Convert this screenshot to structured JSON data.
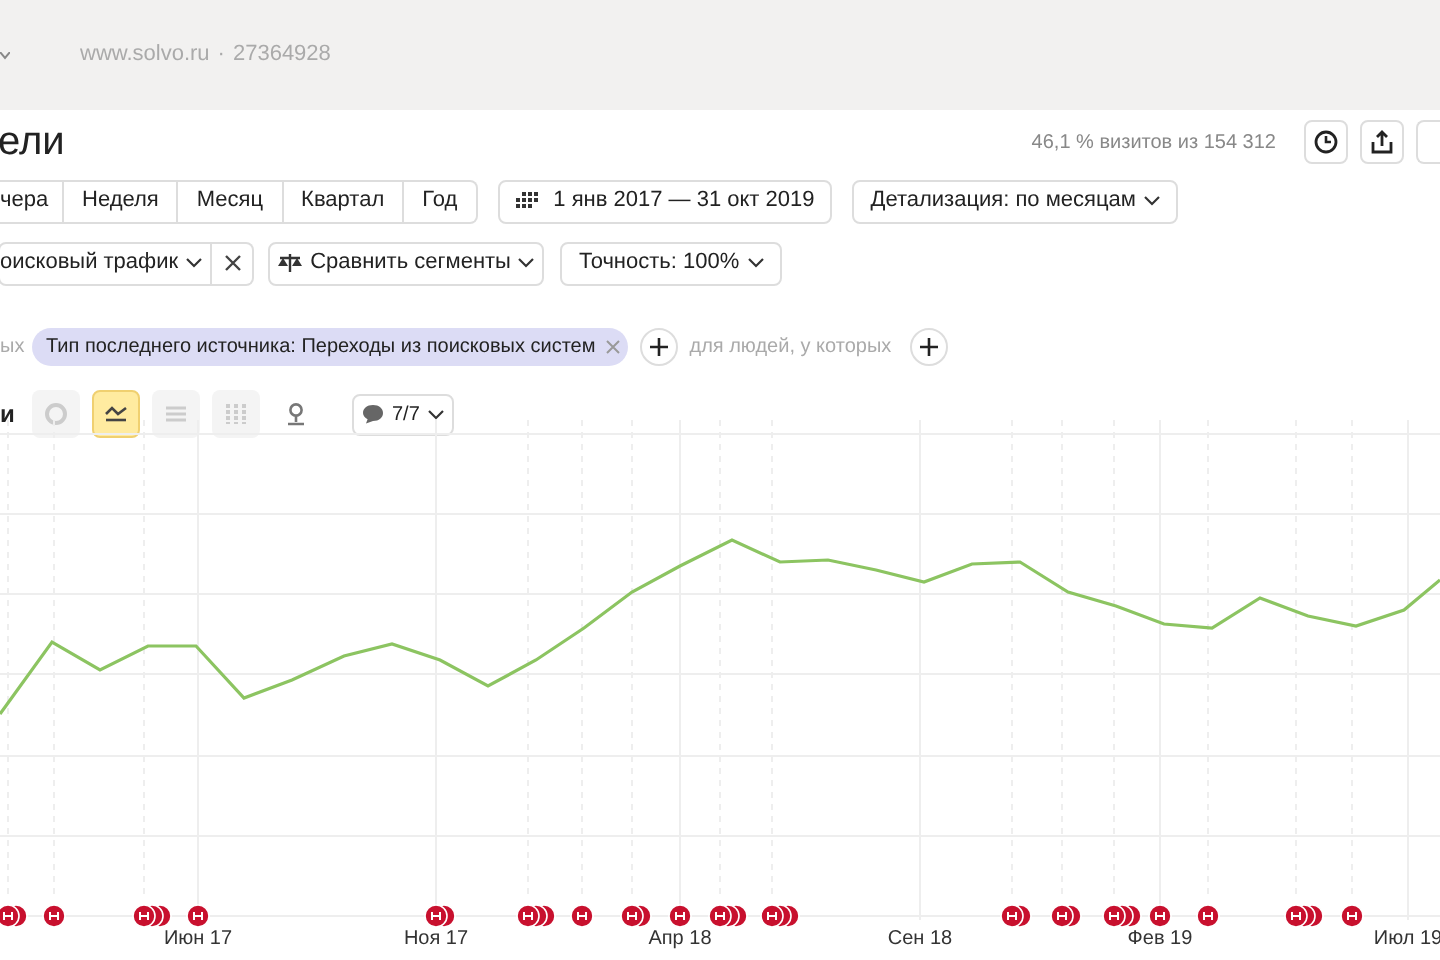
{
  "top_bar": {
    "site": "www.solvo.ru",
    "separator": "·",
    "counter": "27364928"
  },
  "title": "ели",
  "summary": "46,1 % визитов из 154 312",
  "periods": [
    {
      "label": "чера",
      "selected": false
    },
    {
      "label": "Неделя",
      "selected": false
    },
    {
      "label": "Месяц",
      "selected": false
    },
    {
      "label": "Квартал",
      "selected": false
    },
    {
      "label": "Год",
      "selected": false
    }
  ],
  "date_range": "1 янв 2017 — 31 окт 2019",
  "detail": "Детализация: по месяцам",
  "segment": "оисковый трафик",
  "compare": "Сравнить сегменты",
  "accuracy": "Точность: 100%",
  "filter_prefix": "ых",
  "filter_chip": "Тип последнего источника: Переходы из поисковых систем",
  "filter_people": "для людей, у которых",
  "chart_label": "и",
  "chart_types": [
    {
      "kind": "pie",
      "selected": false
    },
    {
      "kind": "line",
      "selected": true
    },
    {
      "kind": "area",
      "selected": false
    },
    {
      "kind": "bars",
      "selected": false
    },
    {
      "kind": "map",
      "selected": false
    }
  ],
  "notes_count": "7/7",
  "x_labels": [
    "Июн 17",
    "Ноя 17",
    "Апр 18",
    "Сен 18",
    "Фев 19",
    "Июл 19"
  ]
}
